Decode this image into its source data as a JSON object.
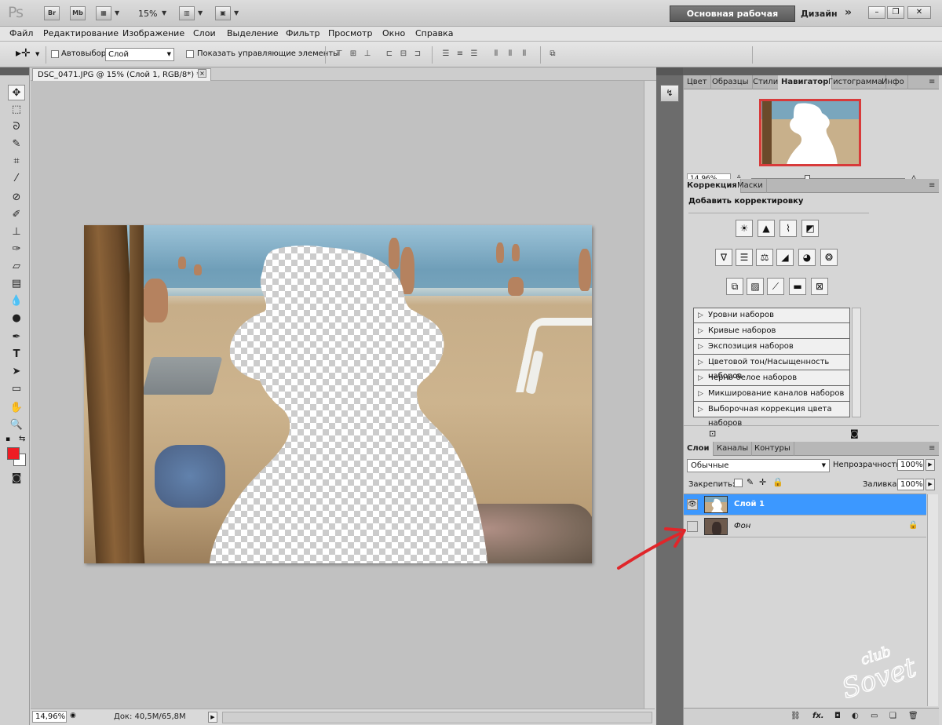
{
  "titlebar": {
    "app_logo": "Ps",
    "bridge_btn": "Br",
    "minibridge_btn": "Mb",
    "zoom": "15%",
    "workspace": "Основная рабочая среда",
    "design": "Дизайн",
    "more": "»"
  },
  "menu": [
    "Файл",
    "Редактирование",
    "Изображение",
    "Слои",
    "Выделение",
    "Фильтр",
    "Просмотр",
    "Окно",
    "Справка"
  ],
  "options": {
    "autoselect_label": "Автовыбор:",
    "autoselect_value": "Слой",
    "show_controls_label": "Показать управляющие элементы"
  },
  "document": {
    "tab_title": "DSC_0471.JPG @ 15% (Слой 1, RGB/8*) *",
    "close": "×"
  },
  "status": {
    "zoom": "14,96%",
    "doc": "Док: 40,5M/65,8M"
  },
  "panels_top": {
    "tabs": [
      "Цвет",
      "Образцы",
      "Стили",
      "Навигатор",
      "Гистограмма",
      "Инфо"
    ],
    "active_tab": "Навигатор",
    "nav_zoom": "14.96%"
  },
  "adjustments": {
    "tabs": [
      "Коррекция",
      "Маски"
    ],
    "title": "Добавить корректировку",
    "presets": [
      "Уровни наборов",
      "Кривые наборов",
      "Экспозиция наборов",
      "Цветовой тон/Насыщенность наборов",
      "Черно-белое наборов",
      "Микширование каналов наборов",
      "Выборочная коррекция цвета наборов"
    ]
  },
  "layers": {
    "tabs": [
      "Слои",
      "Каналы",
      "Контуры"
    ],
    "blend_mode": "Обычные",
    "opacity_label": "Непрозрачность:",
    "opacity": "100%",
    "lock_label": "Закрепить:",
    "fill_label": "Заливка:",
    "fill": "100%",
    "items": [
      {
        "name": "Слой 1",
        "selected": true,
        "visible": true
      },
      {
        "name": "Фон",
        "selected": false,
        "visible": false,
        "locked": true
      }
    ]
  },
  "colors": {
    "foreground": "#ee1c24",
    "background": "#ffffff",
    "selection": "#3c98ff",
    "arrow": "#e0262a"
  },
  "watermark": "club Sovet"
}
